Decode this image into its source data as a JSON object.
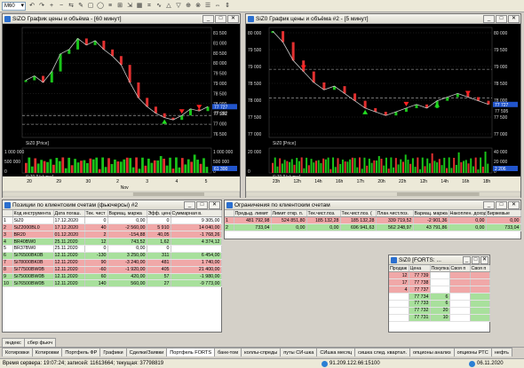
{
  "toolbar": {
    "interval": "M60",
    "buttons": [
      "↶",
      "↷",
      "+",
      "−",
      "⇆",
      "✎",
      "▢",
      "◯",
      "≡",
      "⊞",
      "⇲",
      "▦",
      "⌗",
      "∿",
      "△",
      "▽",
      "⊕",
      "⊗",
      "☰",
      "⇔",
      "⇕"
    ]
  },
  "chart1": {
    "title": "SiZO График цены и объёма - [60 минут]",
    "price_label": "SiZ0 [Price]",
    "volume_label": "SiZ0 [Volume]",
    "price_ticks": [
      "81 500",
      "81 000",
      "80 500",
      "80 000",
      "79 500",
      "79 000",
      "78 500",
      "78 000",
      "77 500",
      "77 000",
      "76 500"
    ],
    "last_price": "77 727",
    "level_label": "77 282",
    "volume_ticks": [
      "1 000 000",
      "500 000",
      "0"
    ],
    "volume_left_ticks": [
      "1 000 000",
      "500 000",
      "0"
    ],
    "vol_last": "61 300",
    "x_ticks": [
      "20",
      "29",
      "30",
      "2",
      "3",
      "4",
      "5"
    ],
    "month": "Nov",
    "chart_data": {
      "type": "line",
      "series": [
        {
          "values": [
            79100,
            79300,
            79000,
            79500,
            80300,
            80500,
            81000,
            80700,
            80900,
            80500,
            80200,
            79800,
            79000,
            78300,
            77900,
            77600,
            77400,
            77300,
            77500,
            77800,
            77700,
            77900
          ]
        }
      ],
      "ylim": [
        76500,
        81500
      ]
    }
  },
  "chart2": {
    "title": "SiZ0 График цены и объёма #2 - [5 минут]",
    "price_label": "SiZ0 [Price]",
    "volume_label": "SiZ0 [Volume]",
    "price_ticks": [
      "80 000",
      "79 500",
      "79 000",
      "78 500",
      "78 000",
      "77 500",
      "77 000"
    ],
    "last_price": "77 727",
    "level_label": "77 595",
    "volume_ticks": [
      "40 000",
      "20 000",
      "0"
    ],
    "volume_left_ticks": [
      "20 000",
      "0"
    ],
    "vol_last": "2 206",
    "x_ticks": [
      "23h",
      "12h",
      "14h",
      "16h",
      "17h",
      "20h",
      "22h",
      "12h",
      "14h",
      "16h",
      "18h"
    ],
    "chart_data": {
      "type": "line",
      "series": [
        {
          "values": [
            79900,
            79600,
            79100,
            78800,
            78500,
            78300,
            78400,
            78200,
            78000,
            77800,
            77700,
            77600,
            77700,
            77800,
            77900,
            77800,
            78000,
            78100,
            78200,
            78100,
            78000,
            77900
          ]
        }
      ],
      "ylim": [
        77000,
        80000
      ]
    }
  },
  "positions": {
    "title": "Позиции по клиентским счетам (фьючерсы) #2",
    "headers": [
      "",
      "Код инструмента",
      "Дата погаш.",
      "Тек. чист",
      "Вариац. маржа",
      "Эфф. цена",
      "Суммарная в."
    ],
    "rows": [
      {
        "n": "1",
        "code": "SiZ0",
        "date": "17.12.2020",
        "pos": "0",
        "var": "0,00",
        "eff": "0",
        "sum": "9 305,00",
        "color": "#ffffff"
      },
      {
        "n": "2",
        "code": "SiZ2000BL0",
        "date": "17.12.2020",
        "pos": "40",
        "var": "-2 560,00",
        "eff": "5 910",
        "sum": "14 040,00",
        "color": "#f0a8a8"
      },
      {
        "n": "3",
        "code": "BR20",
        "date": "01.12.2020",
        "pos": "2",
        "var": "-154,88",
        "eff": "40,05",
        "sum": "-1 768,26",
        "color": "#f0a8a8"
      },
      {
        "n": "4",
        "code": "BR40BW0",
        "date": "25.11.2020",
        "pos": "12",
        "var": "743,52",
        "eff": "1,62",
        "sum": "4 374,12",
        "color": "#a8e09c"
      },
      {
        "n": "5",
        "code": "BR37BW0",
        "date": "25.11.2020",
        "pos": "0",
        "var": "0,00",
        "eff": "0",
        "sum": "",
        "color": "#ffffff"
      },
      {
        "n": "6",
        "code": "Si76500BK0B",
        "date": "12.11.2020",
        "pos": "-130",
        "var": "3 250,00",
        "eff": "311",
        "sum": "6 454,00",
        "color": "#a8e09c"
      },
      {
        "n": "7",
        "code": "Si78000BK0B",
        "date": "12.11.2020",
        "pos": "90",
        "var": "-3 240,00",
        "eff": "481",
        "sum": "1 740,00",
        "color": "#f0a8a8"
      },
      {
        "n": "8",
        "code": "Si77500BW0B",
        "date": "12.11.2020",
        "pos": "-60",
        "var": "-1 920,00",
        "eff": "405",
        "sum": "21 400,00",
        "color": "#f0a8a8"
      },
      {
        "n": "9",
        "code": "Si75000BW0B",
        "date": "12.11.2020",
        "pos": "60",
        "var": "420,00",
        "eff": "57",
        "sum": "-1 980,00",
        "color": "#a8e09c"
      },
      {
        "n": "10",
        "code": "Si76500BW0B",
        "date": "12.11.2020",
        "pos": "140",
        "var": "560,00",
        "eff": "27",
        "sum": "-9 773,00",
        "color": "#a8e09c"
      }
    ]
  },
  "limits": {
    "title": "Ограничения по клиентским счетам",
    "headers": [
      "",
      "Предыд. лимит",
      "Лимит откр. п.",
      "Тек.чист.поз.",
      "Тек.чист.поз. (",
      "План.чист.поз.",
      "Вариац. маржа",
      "Накоплен. доход",
      "Биржевые"
    ],
    "rows": [
      {
        "n": "1",
        "a": "481 792,98",
        "b": "524 851,80",
        "c": "185 132,28",
        "d": "185 132,28",
        "e": "339 719,52",
        "f": "-2 901,36",
        "g": "0,00",
        "h": "0,00",
        "color": "#f0a8a8"
      },
      {
        "n": "2",
        "a": "733,04",
        "b": "0,00",
        "c": "0,00",
        "d": "696 941,63",
        "e": "562 248,97",
        "f": "43 791,86",
        "g": "0,00",
        "h": "733,04",
        "color": "#a8e09c"
      }
    ]
  },
  "orderbook": {
    "title": "SiZ0 [FORTS: ...",
    "headers": [
      "Продаж",
      "Цена",
      "Покупка",
      "Своя п",
      "Своя п"
    ],
    "rows": [
      {
        "sell": "12",
        "price": "77 739",
        "buy": "",
        "color": "#f0a8a8"
      },
      {
        "sell": "17",
        "price": "77 738",
        "buy": "",
        "color": "#f0a8a8"
      },
      {
        "sell": "4",
        "price": "77 737",
        "buy": "",
        "color": "#f0a8a8"
      },
      {
        "sell": "",
        "price": "77 734",
        "buy": "6",
        "color": "#a8e09c"
      },
      {
        "sell": "",
        "price": "77 733",
        "buy": "6",
        "color": "#a8e09c"
      },
      {
        "sell": "",
        "price": "77 732",
        "buy": "20",
        "color": "#a8e09c"
      },
      {
        "sell": "",
        "price": "77 731",
        "buy": "10",
        "color": "#a8e09c"
      }
    ]
  },
  "tabs_row1": [
    "яндекс",
    "сбер фьюч"
  ],
  "tabs_row2": [
    "Котировки",
    "Котировки",
    "Портфель ФР",
    "Графики",
    "Сделки/Заявки",
    "Портфель FORTS",
    "банк-том",
    "коллы-спреды",
    "путы СИ-шка",
    "СИшка месяц",
    "сишка след. квартал.",
    "опционы анализ",
    "опционы РТС",
    "нефть"
  ],
  "active_tab": 5,
  "status": {
    "server_time": "Время сервера: 19:07:24; записей: 11613664; текущая: 37798819",
    "ip": "91.209.122.66:15100",
    "date": "06.11.2020"
  }
}
